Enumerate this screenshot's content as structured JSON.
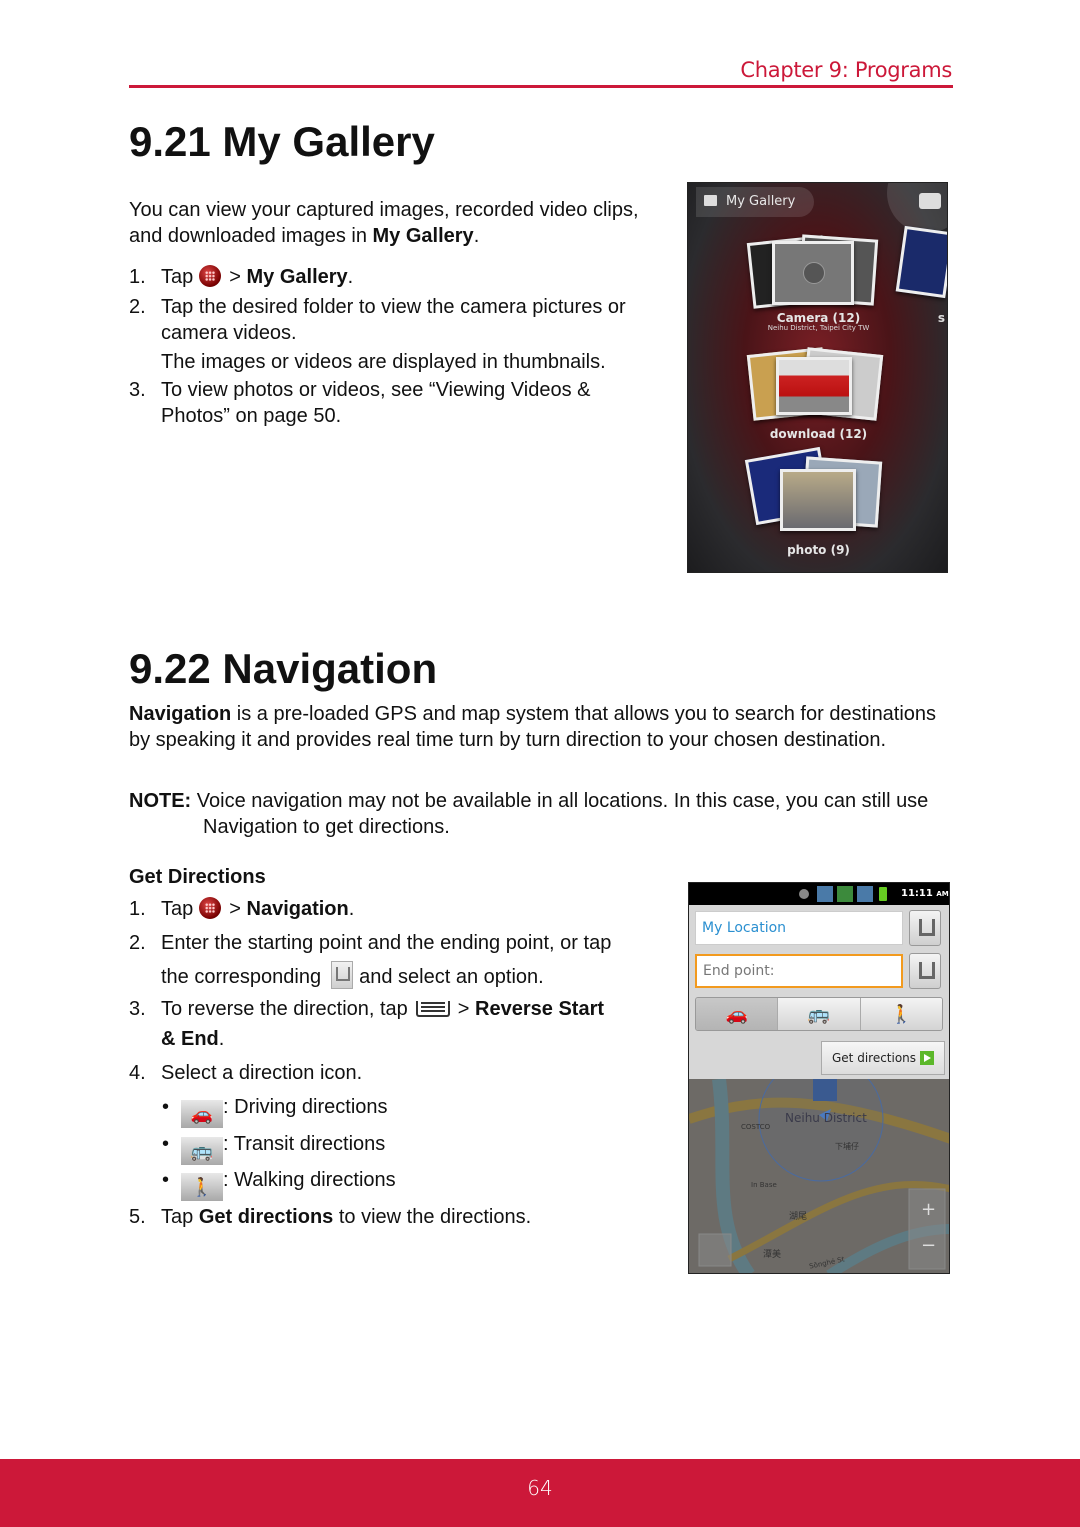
{
  "header": {
    "chapter": "Chapter 9: Programs",
    "accent_color": "#cc1839"
  },
  "gallery_section": {
    "title": "9.21 My Gallery",
    "intro_text": "You can view your captured images, recorded video clips, and downloaded images in ",
    "intro_bold": "My Gallery",
    "steps": [
      {
        "num": "1.",
        "pre": "Tap",
        "icon": "app-drawer-icon",
        "post": "> ",
        "bold": "My Gallery",
        "end": "."
      },
      {
        "num": "2.",
        "text": "Tap the desired folder to view the camera pictures or camera videos.",
        "note": "The images or videos are displayed in thumbnails."
      },
      {
        "num": "3.",
        "text": "To view photos or videos, see “Viewing Videos & Photos” on page 50."
      }
    ],
    "screenshot": {
      "title": "My Gallery",
      "albums": [
        {
          "name": "Camera  (12)",
          "location": "Neihu District, Taipei City TW"
        },
        {
          "name": "download  (12)"
        },
        {
          "name": "photo  (9)"
        }
      ],
      "partial_label": "s"
    }
  },
  "navigation_section": {
    "title": "9.22 Navigation",
    "intro_bold": "Navigation",
    "intro_text": " is a pre-loaded GPS and map system that allows you to search for destinations by speaking it and provides real time turn by turn direction to your chosen destination.",
    "note_label": "NOTE:",
    "note_text": " Voice navigation may not be available in all locations. In this case, you can still use Navigation to get directions.",
    "subheading": "Get Directions",
    "steps": [
      {
        "num": "1.",
        "pre": "Tap",
        "post": "> ",
        "bold": "Navigation",
        "end": "."
      },
      {
        "num": "2.",
        "line1": "Enter the starting point and the ending point, or tap",
        "line2_pre": "the corresponding",
        "line2_post": "and select an option."
      },
      {
        "num": "3.",
        "pre": "To reverse the direction, tap",
        "post": "> ",
        "bold": "Reverse Start",
        "bold2": "& End",
        "end": "."
      },
      {
        "num": "4.",
        "text": "Select a direction icon."
      },
      {
        "num": "5.",
        "pre": "Tap ",
        "bold": "Get directions",
        "post": " to view the directions."
      }
    ],
    "direction_icons": [
      {
        "icon": "car-icon",
        "label": ": Driving directions"
      },
      {
        "icon": "bus-icon",
        "label": ": Transit directions"
      },
      {
        "icon": "walk-icon",
        "label": ": Walking directions"
      }
    ],
    "screenshot": {
      "time": "11:11",
      "ampm": "AM",
      "start_value": "My Location",
      "end_placeholder": "End point:",
      "get_directions_label": "Get directions",
      "map_labels": [
        "Neihu District",
        "COSTCO",
        "In Base",
        "Sōnghé St",
        "下埔仔",
        "湖尾",
        "潭美"
      ]
    }
  },
  "footer": {
    "page_number": "64"
  }
}
